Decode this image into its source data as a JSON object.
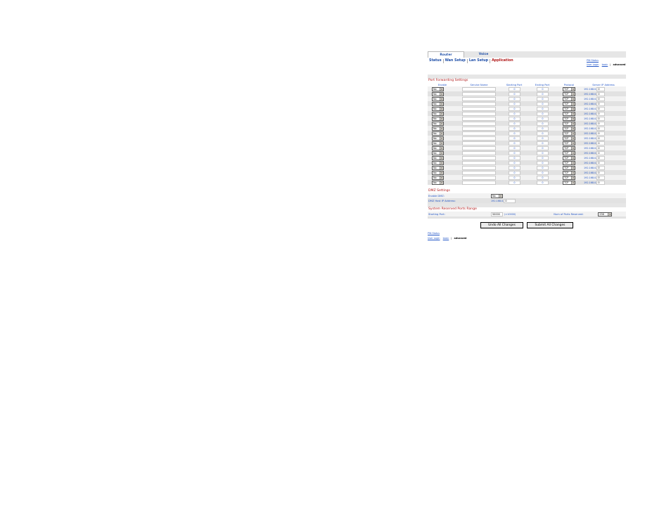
{
  "tabs": {
    "primary": "Router",
    "secondary": "Voice"
  },
  "subtabs": [
    "Status",
    "Wan Setup",
    "Lan Setup",
    "Application"
  ],
  "active_subtab": "Application",
  "links": {
    "pin_status": "PIN Status",
    "user_login": "User Login",
    "basic": "basic",
    "separator": "|",
    "advanced": "advanced"
  },
  "port_forwarding": {
    "title": "Port Forwarding Settings",
    "headers": [
      "Enable",
      "Service Name",
      "Starting Port",
      "Ending Port",
      "Protocol",
      "Server IP Address"
    ],
    "rows": [
      {
        "enable": "No",
        "service": "",
        "start": "0",
        "end": "0",
        "protocol": "TCP",
        "ip_prefix": "192.168.0.",
        "ip_last": "0"
      },
      {
        "enable": "No",
        "service": "",
        "start": "0",
        "end": "0",
        "protocol": "TCP",
        "ip_prefix": "192.168.0.",
        "ip_last": "0"
      },
      {
        "enable": "No",
        "service": "",
        "start": "0",
        "end": "0",
        "protocol": "TCP",
        "ip_prefix": "192.168.0.",
        "ip_last": "0"
      },
      {
        "enable": "No",
        "service": "",
        "start": "0",
        "end": "0",
        "protocol": "TCP",
        "ip_prefix": "192.168.0.",
        "ip_last": "0"
      },
      {
        "enable": "No",
        "service": "",
        "start": "0",
        "end": "0",
        "protocol": "TCP",
        "ip_prefix": "192.168.0.",
        "ip_last": "0"
      },
      {
        "enable": "No",
        "service": "",
        "start": "0",
        "end": "0",
        "protocol": "TCP",
        "ip_prefix": "192.168.0.",
        "ip_last": "0"
      },
      {
        "enable": "No",
        "service": "",
        "start": "0",
        "end": "0",
        "protocol": "TCP",
        "ip_prefix": "192.168.0.",
        "ip_last": "0"
      },
      {
        "enable": "No",
        "service": "",
        "start": "0",
        "end": "0",
        "protocol": "TCP",
        "ip_prefix": "192.168.0.",
        "ip_last": "0"
      },
      {
        "enable": "No",
        "service": "",
        "start": "0",
        "end": "0",
        "protocol": "TCP",
        "ip_prefix": "192.168.0.",
        "ip_last": "0"
      },
      {
        "enable": "No",
        "service": "",
        "start": "0",
        "end": "0",
        "protocol": "TCP",
        "ip_prefix": "192.168.0.",
        "ip_last": "0"
      },
      {
        "enable": "No",
        "service": "",
        "start": "0",
        "end": "0",
        "protocol": "TCP",
        "ip_prefix": "192.168.0.",
        "ip_last": "0"
      },
      {
        "enable": "No",
        "service": "",
        "start": "0",
        "end": "0",
        "protocol": "TCP",
        "ip_prefix": "192.168.0.",
        "ip_last": "0"
      },
      {
        "enable": "No",
        "service": "",
        "start": "0",
        "end": "0",
        "protocol": "TCP",
        "ip_prefix": "192.168.0.",
        "ip_last": "0"
      },
      {
        "enable": "No",
        "service": "",
        "start": "0",
        "end": "0",
        "protocol": "TCP",
        "ip_prefix": "192.168.0.",
        "ip_last": "0"
      },
      {
        "enable": "No",
        "service": "",
        "start": "0",
        "end": "0",
        "protocol": "TCP",
        "ip_prefix": "192.168.0.",
        "ip_last": "0"
      },
      {
        "enable": "No",
        "service": "",
        "start": "0",
        "end": "0",
        "protocol": "TCP",
        "ip_prefix": "192.168.0.",
        "ip_last": "0"
      },
      {
        "enable": "No",
        "service": "",
        "start": "0",
        "end": "0",
        "protocol": "TCP",
        "ip_prefix": "192.168.0.",
        "ip_last": "0"
      },
      {
        "enable": "No",
        "service": "",
        "start": "0",
        "end": "0",
        "protocol": "TCP",
        "ip_prefix": "192.168.0.",
        "ip_last": "0"
      },
      {
        "enable": "No",
        "service": "",
        "start": "0",
        "end": "0",
        "protocol": "TCP",
        "ip_prefix": "192.168.0.",
        "ip_last": "0"
      },
      {
        "enable": "No",
        "service": "",
        "start": "0",
        "end": "0",
        "protocol": "TCP",
        "ip_prefix": "192.168.0.",
        "ip_last": "0"
      }
    ]
  },
  "dmz": {
    "title": "DMZ Settings",
    "enable_label": "Enable DMZ:",
    "enable_value": "No",
    "host_label": "DMZ Host IP Address:",
    "host_prefix": "192.168.0.",
    "host_last": "0"
  },
  "reserved": {
    "title": "System Reserved Ports Range",
    "start_label": "Starting Port:",
    "start_value": "50000",
    "start_note": "(>10000)",
    "num_label": "Num of Ports Reserved:",
    "num_value": "256"
  },
  "buttons": {
    "undo": "Undo All Changes",
    "submit": "Submit All Changes"
  },
  "colors": {
    "link": "#2356c7",
    "title_red": "#b11a1a",
    "tab_blue": "#1f4fa8",
    "row_light": "#f2f2f2",
    "row_dark": "#e2e2e2"
  }
}
